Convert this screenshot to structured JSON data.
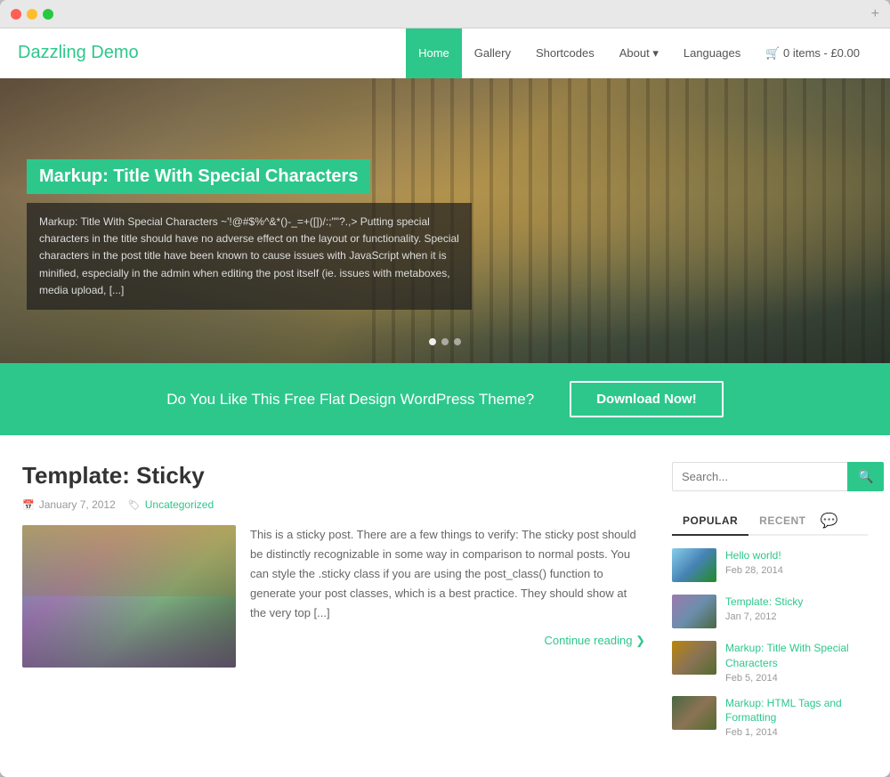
{
  "browser": {
    "plus_label": "+"
  },
  "header": {
    "logo": "Dazzling Demo",
    "nav": [
      {
        "id": "home",
        "label": "Home",
        "active": true
      },
      {
        "id": "gallery",
        "label": "Gallery",
        "active": false
      },
      {
        "id": "shortcodes",
        "label": "Shortcodes",
        "active": false
      },
      {
        "id": "about",
        "label": "About ▾",
        "active": false
      },
      {
        "id": "languages",
        "label": "Languages",
        "active": false
      }
    ],
    "cart": "🛒 0 items - £0.00"
  },
  "hero": {
    "title": "Markup: Title With Special Characters",
    "description": "Markup: Title With Special Characters ~'!@#$%^&*()-_=+([])/:;\"\"?.,> Putting special characters in the title should have no adverse effect on the layout or functionality. Special characters in the post title have been known to cause issues with JavaScript when it is minified, especially in the admin when editing the post itself (ie. issues with metaboxes, media upload, [...]",
    "dots": [
      {
        "active": true
      },
      {
        "active": false
      },
      {
        "active": false
      }
    ]
  },
  "cta": {
    "text": "Do You Like This Free Flat Design WordPress Theme?",
    "button": "Download Now!"
  },
  "post": {
    "title": "Template: Sticky",
    "meta_date": "January 7, 2012",
    "meta_category": "Uncategorized",
    "excerpt": "This is a sticky post. There are a few things to verify: The sticky post should be distinctly recognizable in some way in comparison to normal posts. You can style the .sticky class if you are using the post_class() function to generate your post classes, which is a best practice. They should show at the very top [...]",
    "continue": "Continue reading ❯"
  },
  "sidebar": {
    "search_placeholder": "Search...",
    "search_icon": "🔍",
    "tabs": [
      {
        "label": "POPULAR",
        "active": true
      },
      {
        "label": "RECENT",
        "active": false
      }
    ],
    "comment_icon": "💬",
    "recent_posts": [
      {
        "id": 1,
        "title": "Hello world!",
        "date": "Feb 28, 2014",
        "thumb_class": "rt-1"
      },
      {
        "id": 2,
        "title": "Template: Sticky",
        "date": "Jan 7, 2012",
        "thumb_class": "rt-2"
      },
      {
        "id": 3,
        "title": "Markup: Title With Special Characters",
        "date": "Feb 5, 2014",
        "thumb_class": "rt-3"
      },
      {
        "id": 4,
        "title": "Markup: HTML Tags and Formatting",
        "date": "Feb 1, 2014",
        "thumb_class": "rt-4"
      }
    ]
  }
}
